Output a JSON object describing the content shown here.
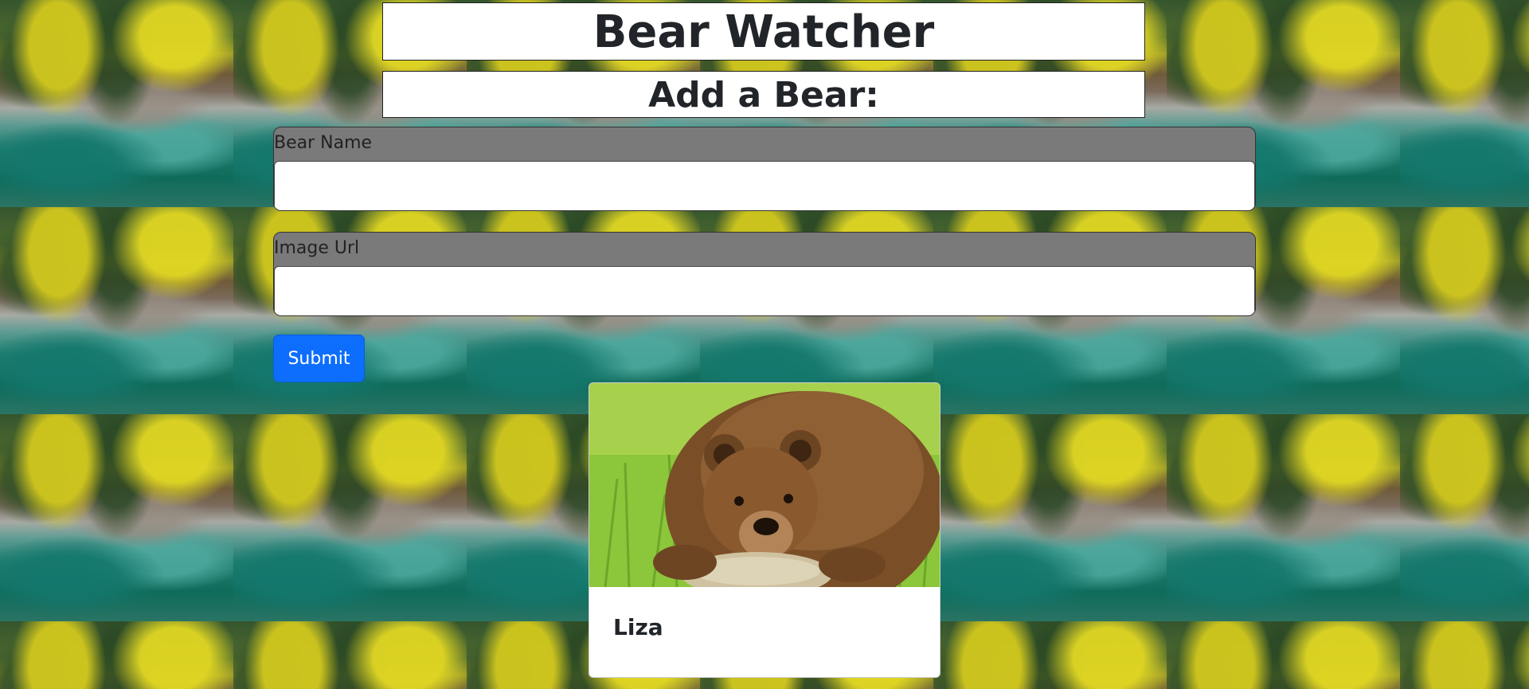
{
  "header": {
    "title": "Bear Watcher"
  },
  "form": {
    "heading": "Add a Bear:",
    "name_label": "Bear Name",
    "name_value": "",
    "url_label": "Image Url",
    "url_value": "",
    "submit_label": "Submit"
  },
  "bears": [
    {
      "name": "Liza",
      "image": "brown-bear-photo"
    }
  ],
  "colors": {
    "primary_button": "#0d6efd",
    "field_group_bg": "#7a7a7a"
  }
}
